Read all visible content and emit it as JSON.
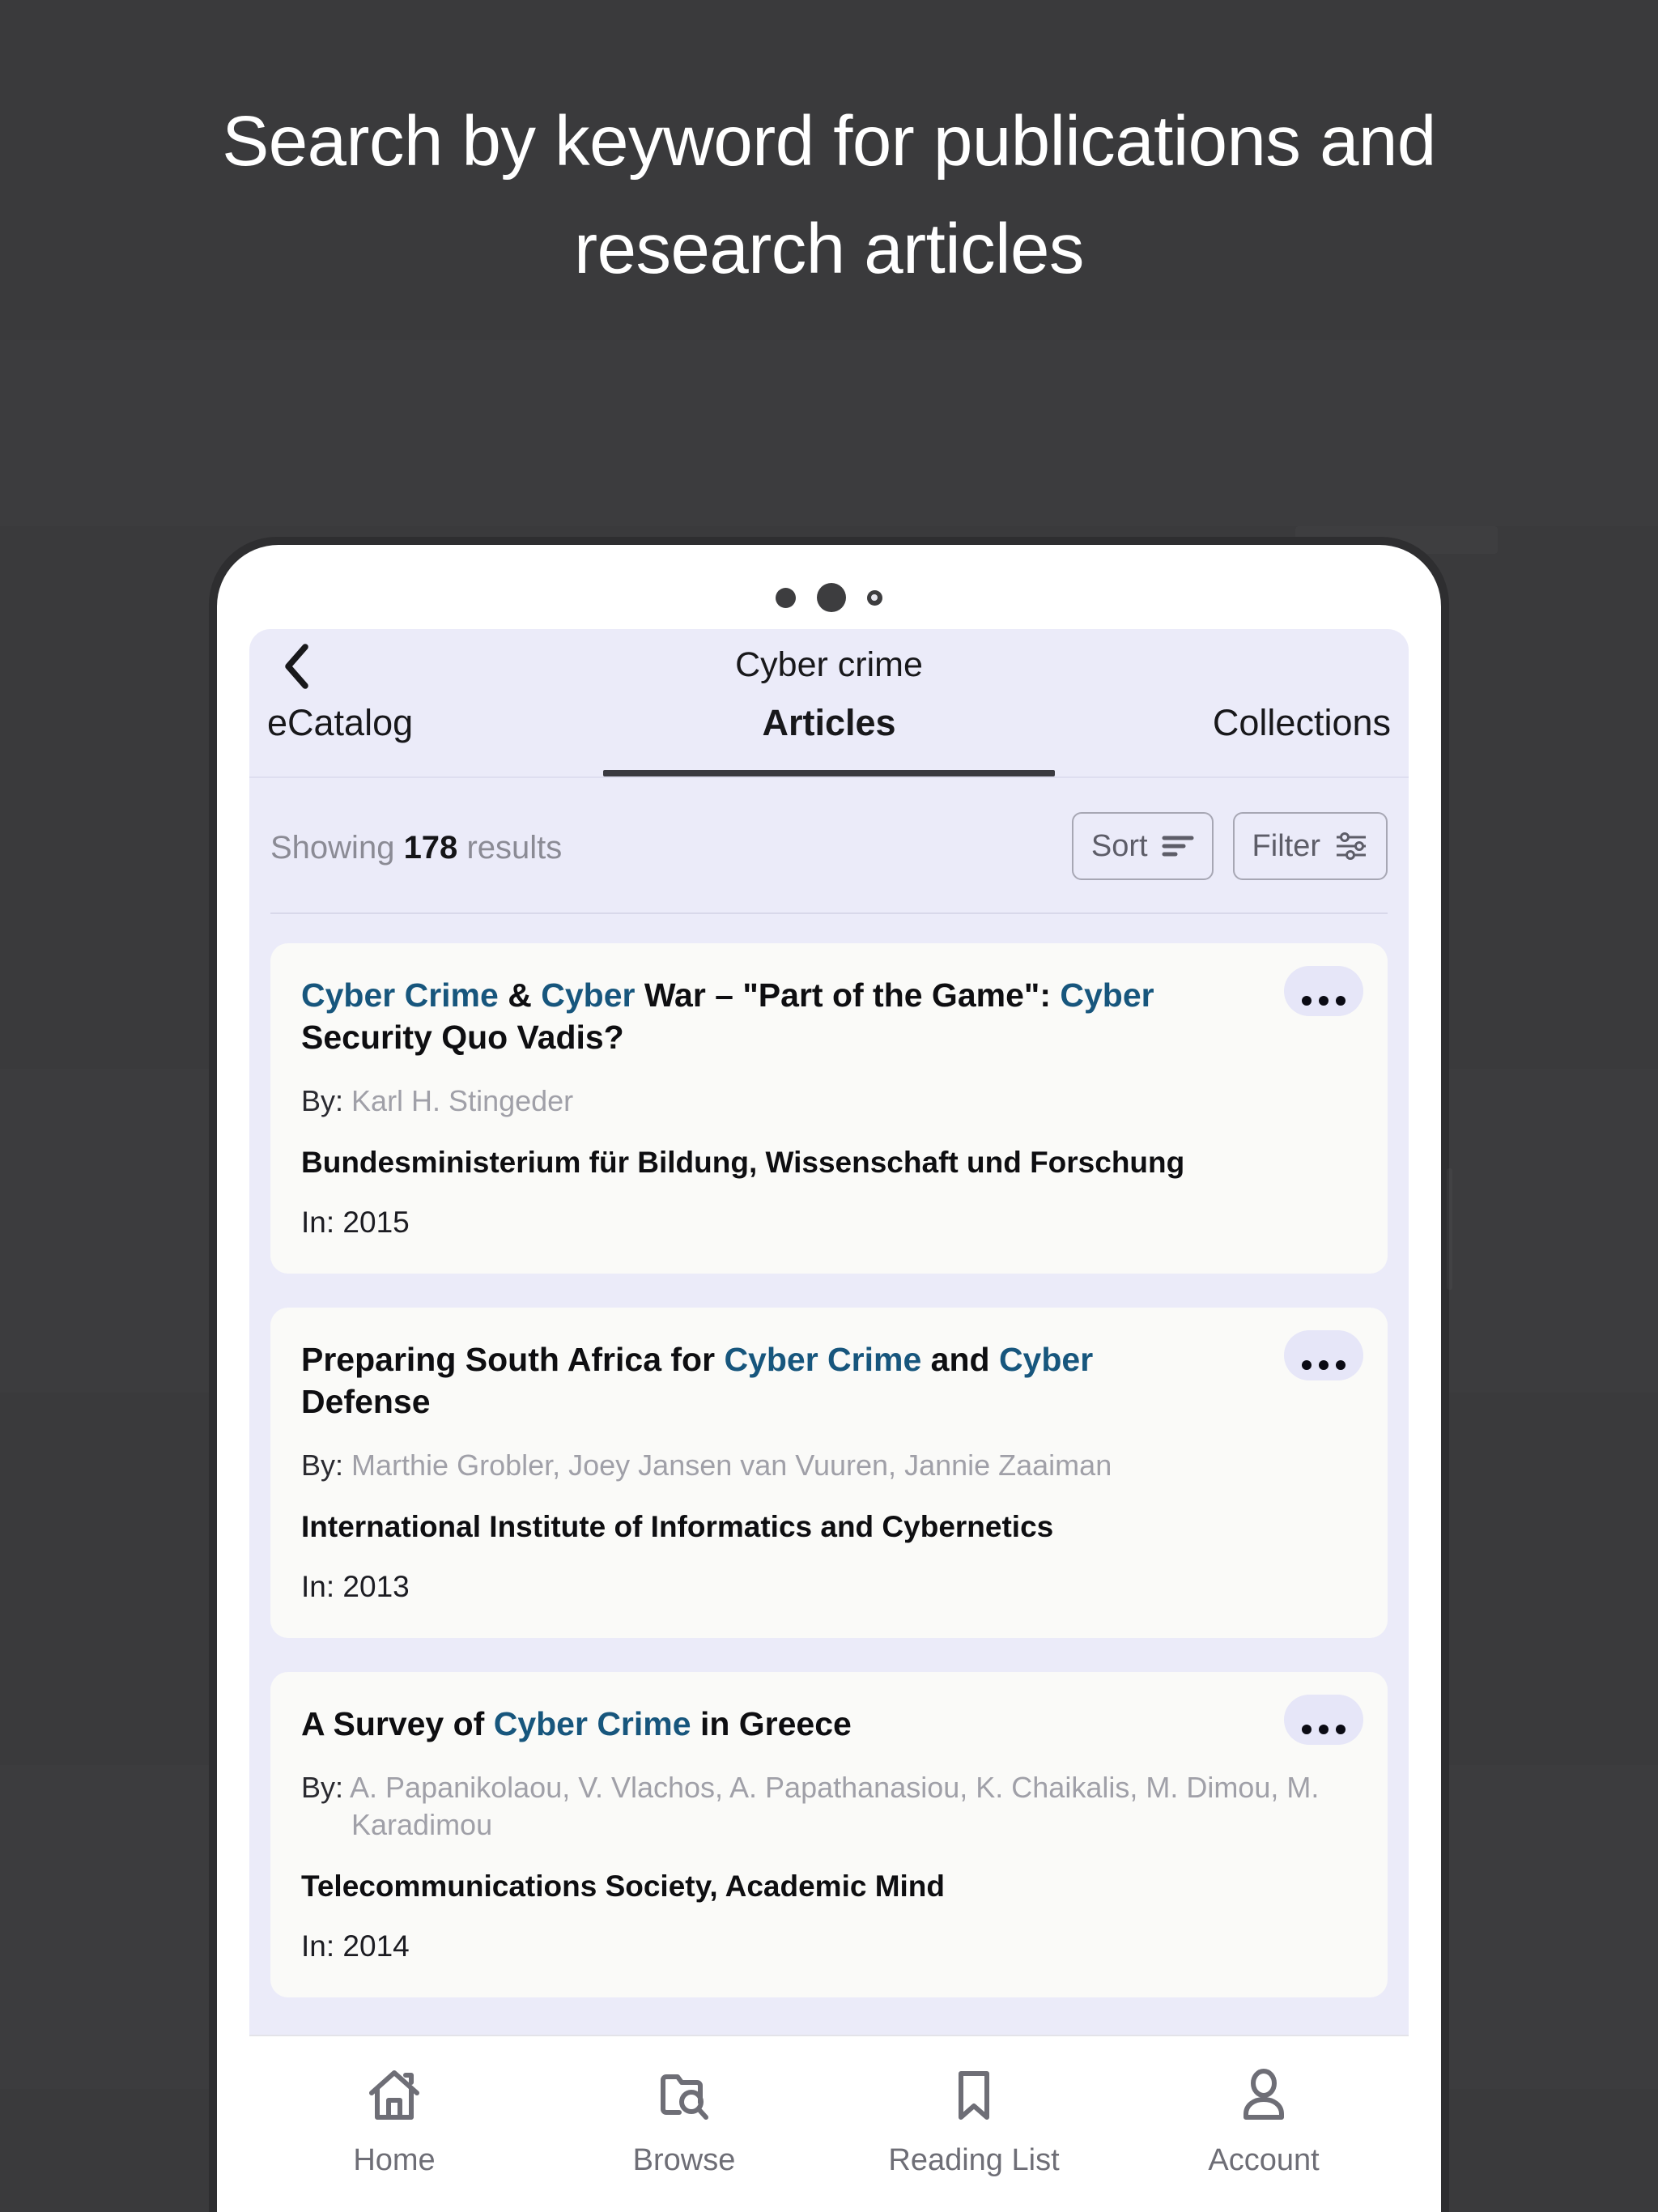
{
  "promo": {
    "headline": "Search by keyword for publications and research articles"
  },
  "phone": {
    "camera": [
      "camera-dot-small",
      "camera-dot-large",
      "camera-sensor-ring"
    ]
  },
  "app": {
    "navbar": {
      "back_icon": "chevron-left-icon",
      "title": "Cyber crime"
    },
    "tabs": [
      {
        "label": "eCatalog",
        "active": false
      },
      {
        "label": "Articles",
        "active": true
      },
      {
        "label": "Collections",
        "active": false
      }
    ],
    "results_bar": {
      "showing_prefix": "Showing",
      "count": "178",
      "showing_suffix": "results",
      "sort_label": "Sort",
      "sort_icon": "sort-lines-icon",
      "filter_label": "Filter",
      "filter_icon": "filter-sliders-icon"
    },
    "results": [
      {
        "title_parts": [
          {
            "text": "Cyber Crime",
            "highlight": true
          },
          {
            "text": " & ",
            "highlight": false
          },
          {
            "text": "Cyber",
            "highlight": true
          },
          {
            "text": " War – \"Part of the Game\": ",
            "highlight": false
          },
          {
            "text": "Cyber",
            "highlight": true
          },
          {
            "text": " Security Quo Vadis?",
            "highlight": false
          }
        ],
        "by_label": "By:",
        "authors": "Karl H. Stingeder",
        "publisher": "Bundesministerium für Bildung, Wissenschaft und Forschung",
        "in": "In: 2015",
        "more_label": "more-options"
      },
      {
        "title_parts": [
          {
            "text": "Preparing South Africa for ",
            "highlight": false
          },
          {
            "text": "Cyber Crime",
            "highlight": true
          },
          {
            "text": " and ",
            "highlight": false
          },
          {
            "text": "Cyber",
            "highlight": true
          },
          {
            "text": " Defense",
            "highlight": false
          }
        ],
        "by_label": "By:",
        "authors": "Marthie Grobler, Joey Jansen van Vuuren, Jannie Zaaiman",
        "publisher": "International Institute of Informatics and Cybernetics",
        "in": "In: 2013",
        "more_label": "more-options"
      },
      {
        "title_parts": [
          {
            "text": "A Survey of ",
            "highlight": false
          },
          {
            "text": "Cyber Crime",
            "highlight": true
          },
          {
            "text": " in Greece",
            "highlight": false
          }
        ],
        "by_label": "By:",
        "authors": "A. Papanikolaou, V. Vlachos, A. Papathanasiou, K. Chaikalis, M. Dimou, M. Karadimou",
        "publisher": "Telecommunications Society, Academic Mind",
        "in": "In: 2014",
        "more_label": "more-options"
      }
    ],
    "bottom_nav": [
      {
        "label": "Home",
        "icon": "home-icon"
      },
      {
        "label": "Browse",
        "icon": "folder-search-icon"
      },
      {
        "label": "Reading List",
        "icon": "bookmark-icon"
      },
      {
        "label": "Account",
        "icon": "person-icon"
      }
    ]
  },
  "colors": {
    "background": "#3a3a3c",
    "screen_bg": "#ebebf9",
    "card_bg": "#fafaf8",
    "link": "#17567d",
    "muted_text": "#a0a0a8",
    "nav_icon": "#6e6e76"
  }
}
